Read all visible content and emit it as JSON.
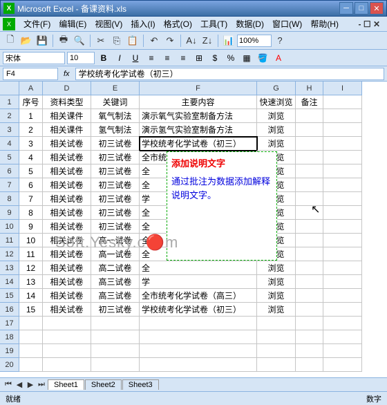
{
  "window": {
    "title": "Microsoft Excel - 备课资料.xls"
  },
  "menu": {
    "file": "文件(F)",
    "edit": "编辑(E)",
    "view": "视图(V)",
    "insert": "插入(I)",
    "format": "格式(O)",
    "tools": "工具(T)",
    "data": "数据(D)",
    "window": "窗口(W)",
    "help": "帮助(H)"
  },
  "toolbar": {
    "zoom": "100%"
  },
  "format": {
    "font": "宋体",
    "size": "10"
  },
  "formula": {
    "cellref": "F4",
    "fx": "fx",
    "value": "学校统考化学试卷（初三）"
  },
  "columns": [
    "A",
    "D",
    "E",
    "F",
    "G",
    "H",
    "I"
  ],
  "headers": {
    "A": "序号",
    "D": "资料类型",
    "E": "关键词",
    "F": "主要内容",
    "G": "快速浏览",
    "H": "备注"
  },
  "rows": [
    {
      "n": "1",
      "d": "相关课件",
      "e": "氧气制法",
      "f": "演示氧气实验室制备方法",
      "g": "浏览"
    },
    {
      "n": "2",
      "d": "相关课件",
      "e": "氢气制法",
      "f": "演示氢气实验室制备方法",
      "g": "浏览"
    },
    {
      "n": "3",
      "d": "相关试卷",
      "e": "初三试卷",
      "f": "学校统考化学试卷（初三）",
      "g": "浏览"
    },
    {
      "n": "4",
      "d": "相关试卷",
      "e": "初三试卷",
      "f": "全市统考化学试卷（初三）",
      "g": "浏览"
    },
    {
      "n": "5",
      "d": "相关试卷",
      "e": "初三试卷",
      "f": "全",
      "g": "浏览"
    },
    {
      "n": "6",
      "d": "相关试卷",
      "e": "初三试卷",
      "f": "全",
      "g": "浏览"
    },
    {
      "n": "7",
      "d": "相关试卷",
      "e": "初三试卷",
      "f": "学",
      "g": "浏览"
    },
    {
      "n": "8",
      "d": "相关试卷",
      "e": "初三试卷",
      "f": "全",
      "g": "浏览"
    },
    {
      "n": "9",
      "d": "相关试卷",
      "e": "初三试卷",
      "f": "全",
      "g": "浏览"
    },
    {
      "n": "10",
      "d": "相关试卷",
      "e": "高一试卷",
      "f": "全",
      "g": "浏览"
    },
    {
      "n": "11",
      "d": "相关试卷",
      "e": "高一试卷",
      "f": "全",
      "g": "浏览"
    },
    {
      "n": "12",
      "d": "相关试卷",
      "e": "高二试卷",
      "f": "全",
      "g": "浏览"
    },
    {
      "n": "13",
      "d": "相关试卷",
      "e": "高三试卷",
      "f": "学",
      "g": "浏览"
    },
    {
      "n": "14",
      "d": "相关试卷",
      "e": "高三试卷",
      "f": "全市统考化学试卷（高三）",
      "g": "浏览"
    },
    {
      "n": "15",
      "d": "相关试卷",
      "e": "初三试卷",
      "f": "学校统考化学试卷（初三）",
      "g": "浏览"
    }
  ],
  "extra_rows": [
    "17",
    "18",
    "19",
    "20"
  ],
  "comment": {
    "title": "添加说明文字",
    "body": "通过批注为数据添加解释说明文字。"
  },
  "watermark": "Soft.Yesky.c🔴m",
  "sheets": {
    "s1": "Sheet1",
    "s2": "Sheet2",
    "s3": "Sheet3"
  },
  "status": {
    "left": "就绪",
    "right": "数字"
  }
}
